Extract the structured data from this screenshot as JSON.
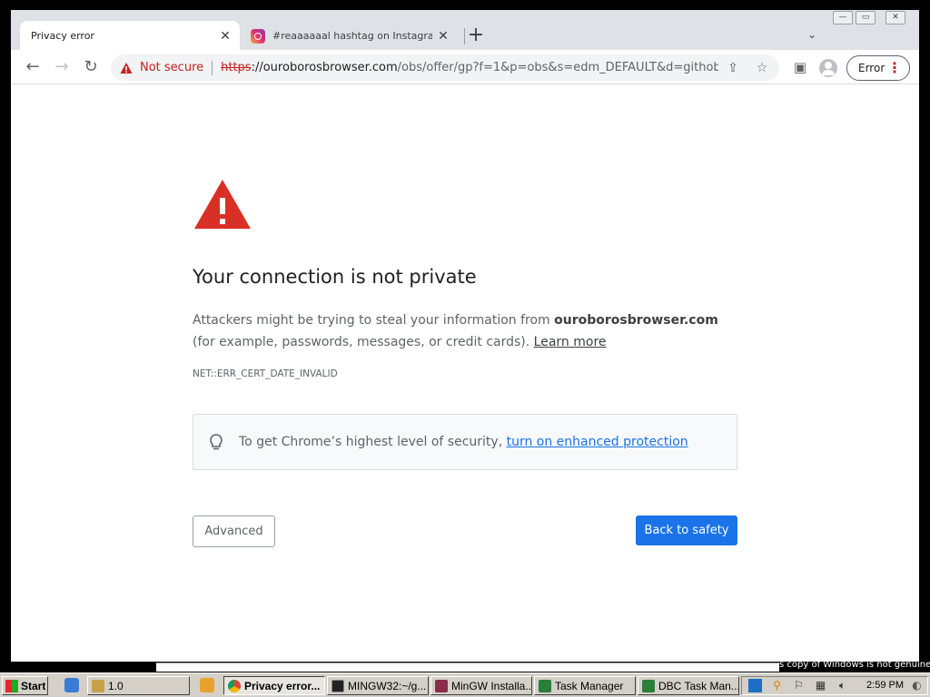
{
  "browser": {
    "tabs": [
      {
        "title": "Privacy error",
        "active": true
      },
      {
        "title": "#reaaaaaal hashtag on Instagram",
        "active": false
      }
    ],
    "new_tab_symbol": "+",
    "toolbar": {
      "not_secure_label": "Not secure",
      "url": {
        "scheme": "https",
        "host": "://ouroborosbrowser.com",
        "path": "/obs/offer/gp?f=1&p=obs&s=edm_DEFAULT&d=githob...."
      },
      "error_chip_label": "Error"
    },
    "icons": [
      "back-icon",
      "forward-icon",
      "reload-icon",
      "warning-icon",
      "share-icon",
      "star-icon",
      "sidepanel-icon",
      "profile-icon",
      "menu-icon",
      "tab-search-icon",
      "lightbulb-icon"
    ]
  },
  "interstitial": {
    "heading": "Your connection is not private",
    "body": {
      "part1": "Attackers might be trying to steal your information from ",
      "domain": "ouroborosbrowser.com",
      "part2": " (for example, passwords, messages, or credit cards). ",
      "learn_more": "Learn more"
    },
    "error_code": "NET::ERR_CERT_DATE_INVALID",
    "enhanced_box": {
      "text": "To get Chrome’s highest level of security, ",
      "link": "turn on enhanced protection"
    },
    "advanced_label": "Advanced",
    "back_label": "Back to safety",
    "colors": {
      "warning_red": "#d93025",
      "primary_blue": "#1a73e8"
    }
  },
  "windows_notice": "s copy of Windows is not genuine",
  "taskbar": {
    "start_label": "Start",
    "items": [
      {
        "label": "1.0",
        "pressed": false
      },
      {
        "label": "Privacy error...",
        "pressed": true
      },
      {
        "label": "MINGW32:~/g...",
        "pressed": false
      },
      {
        "label": "MinGW Installa...",
        "pressed": false
      },
      {
        "label": "Task Manager",
        "pressed": false
      },
      {
        "label": "DBC Task Man...",
        "pressed": false
      }
    ],
    "clock": "2:59 PM"
  }
}
